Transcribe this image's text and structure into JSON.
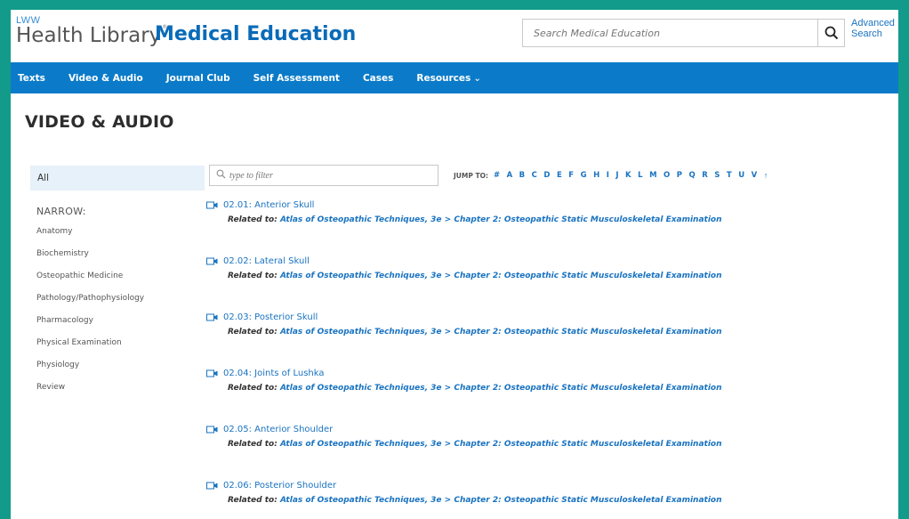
{
  "header": {
    "logo_small": "LWW",
    "logo_main": "Health Library",
    "logo_tm": "®",
    "site_title": "Medical Education",
    "search_placeholder": "Search Medical Education",
    "advanced_search_label": "Advanced Search"
  },
  "nav": {
    "items": [
      {
        "label": "Texts"
      },
      {
        "label": "Video & Audio"
      },
      {
        "label": "Journal Club"
      },
      {
        "label": "Self Assessment"
      },
      {
        "label": "Cases"
      },
      {
        "label": "Resources"
      }
    ],
    "resources_chevron": "⌄"
  },
  "page_title": "VIDEO & AUDIO",
  "sidebar": {
    "all_label": "All",
    "narrow_label": "NARROW:",
    "items": [
      {
        "label": "Anatomy"
      },
      {
        "label": "Biochemistry"
      },
      {
        "label": "Osteopathic Medicine"
      },
      {
        "label": "Pathology/Pathophysiology"
      },
      {
        "label": "Pharmacology"
      },
      {
        "label": "Physical Examination"
      },
      {
        "label": "Physiology"
      },
      {
        "label": "Review"
      }
    ]
  },
  "filter": {
    "placeholder": "type to filter"
  },
  "jump": {
    "label": "JUMP TO:",
    "letters": [
      "#",
      "A",
      "B",
      "C",
      "D",
      "E",
      "F",
      "G",
      "H",
      "I",
      "J",
      "K",
      "L",
      "M",
      "O",
      "P",
      "Q",
      "R",
      "S",
      "T",
      "U",
      "V"
    ],
    "top_symbol": "↑"
  },
  "results": [
    {
      "title": "02.01: Anterior Skull",
      "related_label": "Related to:",
      "related_value": "Atlas of Osteopathic Techniques, 3e > Chapter 2: Osteopathic Static Musculoskeletal Examination"
    },
    {
      "title": "02.02: Lateral Skull",
      "related_label": "Related to:",
      "related_value": "Atlas of Osteopathic Techniques, 3e > Chapter 2: Osteopathic Static Musculoskeletal Examination"
    },
    {
      "title": "02.03: Posterior Skull",
      "related_label": "Related to:",
      "related_value": "Atlas of Osteopathic Techniques, 3e > Chapter 2: Osteopathic Static Musculoskeletal Examination"
    },
    {
      "title": "02.04: Joints of Lushka",
      "related_label": "Related to:",
      "related_value": "Atlas of Osteopathic Techniques, 3e > Chapter 2: Osteopathic Static Musculoskeletal Examination"
    },
    {
      "title": "02.05: Anterior Shoulder",
      "related_label": "Related to:",
      "related_value": "Atlas of Osteopathic Techniques, 3e > Chapter 2: Osteopathic Static Musculoskeletal Examination"
    },
    {
      "title": "02.06: Posterior Shoulder",
      "related_label": "Related to:",
      "related_value": "Atlas of Osteopathic Techniques, 3e > Chapter 2: Osteopathic Static Musculoskeletal Examination"
    }
  ],
  "colors": {
    "border_teal": "#129a8b",
    "nav_blue": "#0b7bc9",
    "link_blue": "#1a73c0",
    "title_blue": "#0a6bb8"
  },
  "icons": {
    "search": "search-icon",
    "filter": "search-icon",
    "video": "video-camera-icon"
  }
}
